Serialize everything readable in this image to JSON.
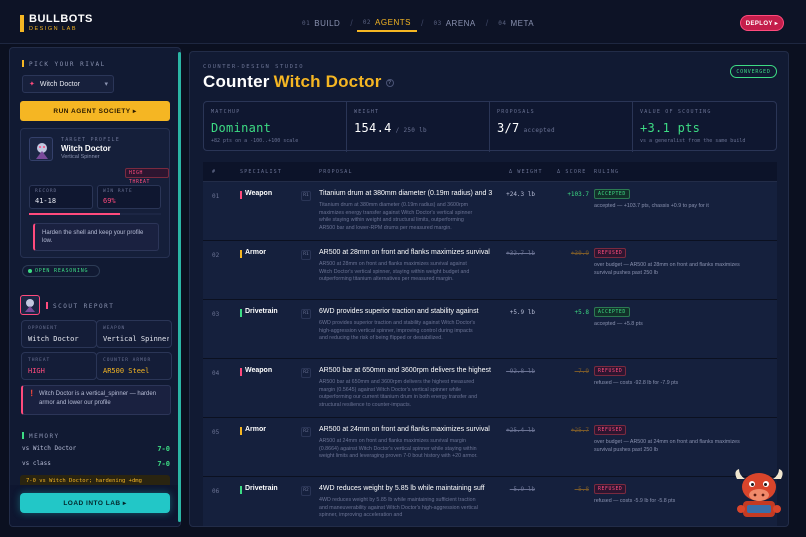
{
  "brand": {
    "name": "BULLBOTS",
    "sub": "DESIGN LAB"
  },
  "nav": {
    "tabs": [
      {
        "num": "01",
        "label": "BUILD"
      },
      {
        "num": "02",
        "label": "AGENTS"
      },
      {
        "num": "03",
        "label": "ARENA"
      },
      {
        "num": "04",
        "label": "META"
      }
    ],
    "sep": "/",
    "deploy_label": "DEPLOY ▸"
  },
  "sidebar": {
    "pick_label": "PICK YOUR RIVAL",
    "rival_value": "Witch Doctor",
    "run_label": "RUN AGENT SOCIETY ▸",
    "target": {
      "section": "TARGET PROFILE",
      "name": "Witch Doctor",
      "type": "Vertical Spinner",
      "threat_badge": "HIGH THREAT",
      "record_label": "RECORD",
      "record_value": "41-18",
      "winrate_label": "WIN RATE",
      "winrate_value": "69%",
      "winrate_fill": 0.69,
      "opinion": "Harden the shell and keep your profile low."
    },
    "open_reasoning": "OPEN REASONING",
    "scout": {
      "label": "SCOUT REPORT",
      "cards": [
        {
          "label": "OPPONENT",
          "value": "Witch Doctor"
        },
        {
          "label": "WEAPON",
          "value": "Vertical Spinner"
        },
        {
          "label": "THREAT",
          "value": "HIGH"
        },
        {
          "label": "COUNTER ARMOR",
          "value": "AR500 Steel"
        }
      ],
      "note": "Witch Doctor is a vertical_spinner — harden armor and lower our profile"
    },
    "memory": {
      "label": "MEMORY",
      "rows": [
        {
          "label": "vs Witch Doctor",
          "value": "7-0"
        },
        {
          "label": "vs class",
          "value": "7-0"
        }
      ],
      "partial": "7-0 vs Witch Doctor; hardening +dmg"
    },
    "load_label": "LOAD INTO LAB ▸"
  },
  "main": {
    "studio_label": "COUNTER-DESIGN STUDIO",
    "title_prefix": "Counter",
    "title_target": "Witch Doctor",
    "help": "?",
    "converged": "CONVERGED",
    "stats": [
      {
        "label": "MATCHUP",
        "value": "Dominant",
        "unit": "",
        "sub": "+82 pts on a -100..+100 scale"
      },
      {
        "label": "WEIGHT",
        "value": "154.4",
        "unit": "/ 250 lb",
        "sub": ""
      },
      {
        "label": "PROPOSALS",
        "value": "3/7",
        "unit": "accepted",
        "sub": ""
      },
      {
        "label": "VALUE OF SCOUTING",
        "value": "+3.1 pts",
        "unit": "",
        "sub": "vs a generalist from the same build"
      }
    ],
    "columns": [
      "#",
      "SPECIALIST",
      "PROPOSAL",
      "Δ WEIGHT",
      "Δ SCORE",
      "RULING"
    ],
    "colors": {
      "Weapon": "#ff4b7d",
      "Armor": "#f5b623",
      "Drivetrain": "#3ddc84"
    },
    "rows": [
      {
        "idx": "01",
        "specialist": "Weapon",
        "round": "R1",
        "title": "Titanium drum at 380mm diameter (0.19m radius) and 3",
        "desc": "Titanium drum at 380mm diameter (0.19m radius) and 3600rpm maximizes energy transfer against Witch Doctor's vertical spinner while staying within weight and structural limits, outperforming AR500 bar and lower-RPM drums per measured margin.",
        "dw": "+24.3 lb",
        "ds": "+103.7",
        "ruling": "ACCEPTED",
        "status": "acc",
        "note": "accepted — +103.7 pts, chassis +0.9 to pay for it"
      },
      {
        "idx": "02",
        "specialist": "Armor",
        "round": "R1",
        "title": "AR500 at 28mm on front and flanks maximizes survival",
        "desc": "AR500 at 28mm on front and flanks maximizes survival against Witch Doctor's vertical spinner, staying within weight budget and outperforming titanium alternatives per measured margin.",
        "dw": "+32.7 lb",
        "ds": "+30.9",
        "ruling": "REFUSED",
        "status": "ref",
        "note": "over budget — AR500 at 28mm on front and flanks maximizes survival pushes past 250 lb"
      },
      {
        "idx": "03",
        "specialist": "Drivetrain",
        "round": "R1",
        "title": "6WD provides superior traction and stability against",
        "desc": "6WD provides superior traction and stability against Witch Doctor's high-aggression vertical spinner, improving control during impacts and reducing the risk of being flipped or destabilized.",
        "dw": "+5.9 lb",
        "ds": "+5.8",
        "ruling": "ACCEPTED",
        "status": "acc",
        "note": "accepted — +5.8 pts"
      },
      {
        "idx": "04",
        "specialist": "Weapon",
        "round": "R2",
        "title": "AR500 bar at 650mm and 3600rpm delivers the highest",
        "desc": "AR500 bar at 650mm and 3600rpm delivers the highest measured margin (0.5645) against Witch Doctor's vertical spinner while outperforming our current titanium drum in both energy transfer and structural resilience to counter-impacts.",
        "dw": "-92.8 lb",
        "ds": "-7.9",
        "ruling": "REFUSED",
        "status": "ref",
        "note": "refused — costs -92.8 lb for -7.9 pts"
      },
      {
        "idx": "05",
        "specialist": "Armor",
        "round": "R2",
        "title": "AR500 at 24mm on front and flanks maximizes survival",
        "desc": "AR500 at 24mm on front and flanks maximizes survival margin (0.8664) against Witch Doctor's vertical spinner while staying within weight limits and leveraging proven 7-0 bout history with +20 armor.",
        "dw": "+25.4 lb",
        "ds": "+25.7",
        "ruling": "REFUSED",
        "status": "ref",
        "note": "over budget — AR500 at 24mm on front and flanks maximizes survival pushes past 250 lb"
      },
      {
        "idx": "06",
        "specialist": "Drivetrain",
        "round": "R2",
        "title": "4WD reduces weight by 5.85 lb while maintaining suff",
        "desc": "4WD reduces weight by 5.85 lb while maintaining sufficient traction and maneuverability against Witch Doctor's high-aggression vertical spinner, improving acceleration and",
        "dw": "-5.9 lb",
        "ds": "-5.8",
        "ruling": "REFUSED",
        "status": "ref",
        "note": "refused — costs -5.9 lb for -5.8 pts"
      }
    ]
  }
}
